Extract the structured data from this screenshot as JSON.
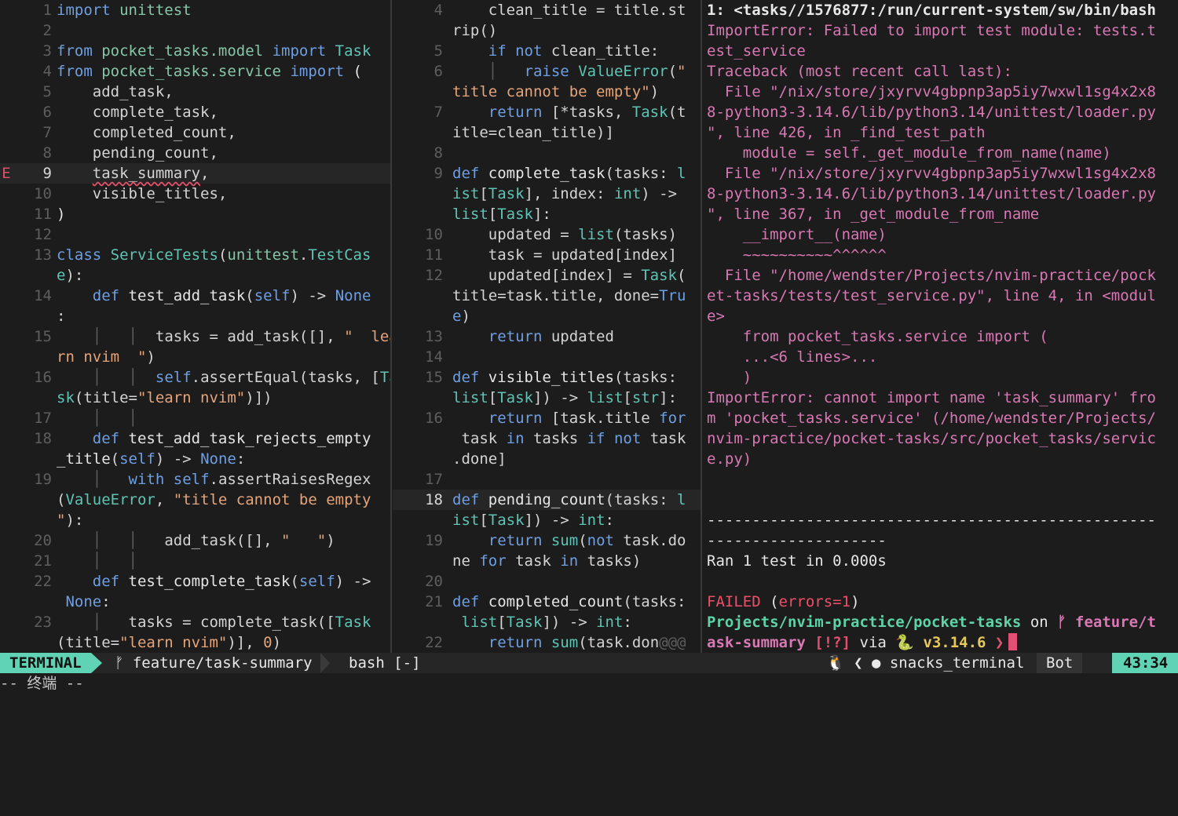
{
  "left": {
    "rows": [
      {
        "n": "1",
        "html": "<span class='k'>import</span> <span class='m'>unittest</span>"
      },
      {
        "n": "2",
        "html": ""
      },
      {
        "n": "3",
        "html": "<span class='k'>from</span> <span class='m'>pocket_tasks.model</span> <span class='k'>import</span> <span class='ty'>Task</span>"
      },
      {
        "n": "4",
        "html": "<span class='k'>from</span> <span class='m'>pocket_tasks.service</span> <span class='k'>import</span> <span class='p'>(</span>"
      },
      {
        "n": "5",
        "html": "    add_task,"
      },
      {
        "n": "6",
        "html": "    complete_task,"
      },
      {
        "n": "7",
        "html": "    completed_count,"
      },
      {
        "n": "8",
        "html": "    pending_count,"
      },
      {
        "n": "9",
        "html": "    <span class='err-u'>task_summary</span>,",
        "cur": true,
        "sign": "E"
      },
      {
        "n": "10",
        "html": "    visible_titles,"
      },
      {
        "n": "11",
        "html": "<span class='p'>)</span>"
      },
      {
        "n": "12",
        "html": ""
      },
      {
        "n": "13",
        "html": "<span class='k'>class</span> <span class='ty'>ServiceTests</span>(<span class='m'>unittest</span>.<span class='ty'>TestCas</span>"
      },
      {
        "n": "",
        "html": "<span class='ty'>e</span>):"
      },
      {
        "n": "14",
        "html": "    <span class='k'>def</span> <span class='fn'>test_add_task</span>(<span class='sf'>self</span>) -&gt; <span class='k'>None</span>"
      },
      {
        "n": "",
        "html": ":"
      },
      {
        "n": "15",
        "html": "    <span class='dim'>│</span>   <span class='dim'>│</span>  tasks = add_task([], <span class='s'>\"  lea</span>"
      },
      {
        "n": "",
        "html": "<span class='s'>rn nvim  \"</span>)"
      },
      {
        "n": "16",
        "html": "    <span class='dim'>│</span>   <span class='dim'>│</span>  <span class='sf'>self</span>.assertEqual(tasks, [<span class='ty'>Ta</span>"
      },
      {
        "n": "",
        "html": "<span class='ty'>sk</span>(title=<span class='s'>\"learn nvim\"</span>)])"
      },
      {
        "n": "17",
        "html": "    <span class='dim'>│</span>   <span class='dim'>│</span>"
      },
      {
        "n": "18",
        "html": "    <span class='k'>def</span> <span class='fn'>test_add_task_rejects_empty</span>"
      },
      {
        "n": "",
        "html": "<span class='fn'>_title</span>(<span class='sf'>self</span>) -&gt; <span class='k'>None</span>:"
      },
      {
        "n": "19",
        "html": "    <span class='dim'>│</span>   <span class='k'>with</span> <span class='sf'>self</span>.assertRaisesRegex"
      },
      {
        "n": "",
        "html": "(<span class='ty'>ValueError</span>, <span class='s'>\"title cannot be empty</span>"
      },
      {
        "n": "",
        "html": "<span class='s'>\"</span>):"
      },
      {
        "n": "20",
        "html": "    <span class='dim'>│</span>   <span class='dim'>│</span>   add_task([], <span class='s'>\"   \"</span>)"
      },
      {
        "n": "21",
        "html": "    <span class='dim'>│</span>   <span class='dim'>│</span>"
      },
      {
        "n": "22",
        "html": "    <span class='k'>def</span> <span class='fn'>test_complete_task</span>(<span class='sf'>self</span>) -&gt;"
      },
      {
        "n": "",
        "html": " <span class='k'>None</span>:"
      },
      {
        "n": "23",
        "html": "    <span class='dim'>│</span>   tasks = complete_task([<span class='ty'>Task</span>"
      },
      {
        "n": "",
        "html": "(title=<span class='s'>\"learn nvim\"</span>)], <span class='n'>0</span>)"
      }
    ]
  },
  "mid": {
    "rows": [
      {
        "n": "4",
        "html": "    clean_title = title.st"
      },
      {
        "n": "",
        "html": "rip()"
      },
      {
        "n": "5",
        "html": "    <span class='k'>if</span> <span class='k'>not</span> clean_title:"
      },
      {
        "n": "6",
        "html": "    <span class='dim'>│</span>   <span class='k'>raise</span> <span class='ty'>ValueError</span>(<span class='s'>\"</span>"
      },
      {
        "n": "",
        "html": "<span class='s'>title cannot be empty\"</span>)"
      },
      {
        "n": "7",
        "html": "    <span class='k'>return</span> [*tasks, <span class='ty'>Task</span>(t"
      },
      {
        "n": "",
        "html": "itle=clean_title)]"
      },
      {
        "n": "8",
        "html": ""
      },
      {
        "n": "9",
        "html": "<span class='k'>def</span> <span class='fn'>complete_task</span>(tasks: <span class='bi'>l</span>"
      },
      {
        "n": "",
        "html": "<span class='bi'>ist</span>[<span class='ty'>Task</span>], index: <span class='bi'>int</span>) -&gt;"
      },
      {
        "n": "",
        "html": "<span class='bi'>list</span>[<span class='ty'>Task</span>]:"
      },
      {
        "n": "10",
        "html": "    updated = <span class='bi'>list</span>(tasks)"
      },
      {
        "n": "11",
        "html": "    task = updated[index]"
      },
      {
        "n": "12",
        "html": "    updated[index] = <span class='ty'>Task</span>("
      },
      {
        "n": "",
        "html": "title=task.title, done=<span class='k'>Tru</span>"
      },
      {
        "n": "",
        "html": "<span class='k'>e</span>)"
      },
      {
        "n": "13",
        "html": "    <span class='k'>return</span> updated"
      },
      {
        "n": "14",
        "html": ""
      },
      {
        "n": "15",
        "html": "<span class='k'>def</span> <span class='fn'>visible_titles</span>(tasks:"
      },
      {
        "n": "",
        "html": "<span class='bi'>list</span>[<span class='ty'>Task</span>]) -&gt; <span class='bi'>list</span>[<span class='bi'>str</span>]:"
      },
      {
        "n": "16",
        "html": "    <span class='k'>return</span> [task.title <span class='k'>for</span>"
      },
      {
        "n": "",
        "html": " task <span class='k'>in</span> tasks <span class='k'>if</span> <span class='k'>not</span> task"
      },
      {
        "n": "",
        "html": ".done]"
      },
      {
        "n": "17",
        "html": ""
      },
      {
        "n": "18",
        "html": "<span class='k'>def</span> <span class='fn'>pending_count</span>(tasks: <span class='bi'>l</span>",
        "cur": true
      },
      {
        "n": "",
        "html": "<span class='bi'>ist</span>[<span class='ty'>Task</span>]) -&gt; <span class='bi'>int</span>:"
      },
      {
        "n": "19",
        "html": "    <span class='k'>return</span> <span class='bi'>sum</span>(<span class='k'>not</span> task.do"
      },
      {
        "n": "",
        "html": "ne <span class='k'>for</span> task <span class='k'>in</span> tasks)"
      },
      {
        "n": "20",
        "html": ""
      },
      {
        "n": "21",
        "html": "<span class='k'>def</span> <span class='fn'>completed_count</span>(tasks:"
      },
      {
        "n": "",
        "html": " <span class='bi'>list</span>[<span class='ty'>Task</span>]) -&gt; <span class='bi'>int</span>:"
      },
      {
        "n": "22",
        "html": "    <span class='k'>return</span> <span class='bi'>sum</span>(task.don<span class='dim'>@@@</span>"
      }
    ]
  },
  "terminal": {
    "rows": [
      "<span class='t-white'>1: &lt;tasks//1576877:/run/current-system/sw/bin/bash</span>",
      "<span class='t-mag'>ImportError</span><span class='t-mag'>: Failed to import test module: tests.t</span>",
      "<span class='t-mag'>est_service</span>",
      "<span class='t-mag'>Traceback (most recent call last):</span>",
      "<span class='t-mag'>  File \"/nix/store/jxyrvv4gbpnp3ap5iy7wxwl1sg4x2x8</span>",
      "<span class='t-mag'>8-python3-3.14.6/lib/python3.14/unittest/loader.py</span>",
      "<span class='t-mag'>\", line 426, in _find_test_path</span>",
      "<span class='t-mag'>    module = self._get_module_from_name(name)</span>",
      "<span class='t-mag'>  File \"/nix/store/jxyrvv4gbpnp3ap5iy7wxwl1sg4x2x8</span>",
      "<span class='t-mag'>8-python3-3.14.6/lib/python3.14/unittest/loader.py</span>",
      "<span class='t-mag'>\", line 367, in _get_module_from_name</span>",
      "<span class='t-mag'>    __import__(name)</span>",
      "<span class='t-mag'>    ~~~~~~~~~~^^^^^^</span>",
      "<span class='t-mag'>  File \"/home/wendster/Projects/nvim-practice/pock</span>",
      "<span class='t-mag'>et-tasks/tests/test_service.py\", line 4, in &lt;modul</span>",
      "<span class='t-mag'>e&gt;</span>",
      "<span class='t-mag'>    from pocket_tasks.service import (</span>",
      "<span class='t-mag'>    ...&lt;6 lines&gt;...</span>",
      "<span class='t-mag'>    )</span>",
      "<span class='t-mag'>ImportError: cannot import name 'task_summary' fro</span>",
      "<span class='t-mag'>m 'pocket_tasks.service' (/home/wendster/Projects/</span>",
      "<span class='t-mag'>nvim-practice/pocket-tasks/src/pocket_tasks/servic</span>",
      "<span class='t-mag'>e.py)</span>",
      "",
      "",
      "<span class='p'>--------------------------------------------------</span>",
      "<span class='p'>--------------------</span>",
      "<span class='p'>Ran 1 test in 0.000s</span>",
      "",
      "<span class='t-red'>FAILED</span> <span class='p'>(</span><span class='t-red'>errors=1</span><span class='p'>)</span>",
      "<span class='t-grn'>Projects/nvim-practice/pocket-tasks</span> <span class='p'>on</span> <span class='t-mag' style='font-weight:bold'>ᚠ feature/t</span>",
      "<span class='t-mag' style='font-weight:bold'>ask-summary</span> <span class='t-pink' style='font-weight:bold'>[!?]</span> <span class='p'>via</span> <span class='t-yel'>🐍 v3.14.6</span> <span class='t-pink' style='font-weight:bold'>❯</span><span class='cursor' data-name='terminal-cursor' data-interactable='false'></span>"
    ]
  },
  "status": {
    "mode": "TERMINAL",
    "branch": "ᚠ feature/task-summary",
    "file": "bash [-]",
    "right": "🐧 ❮ ● snacks_terminal",
    "scroll": "Bot",
    "position": "43:34"
  },
  "cmdline": "-- 终端 --"
}
